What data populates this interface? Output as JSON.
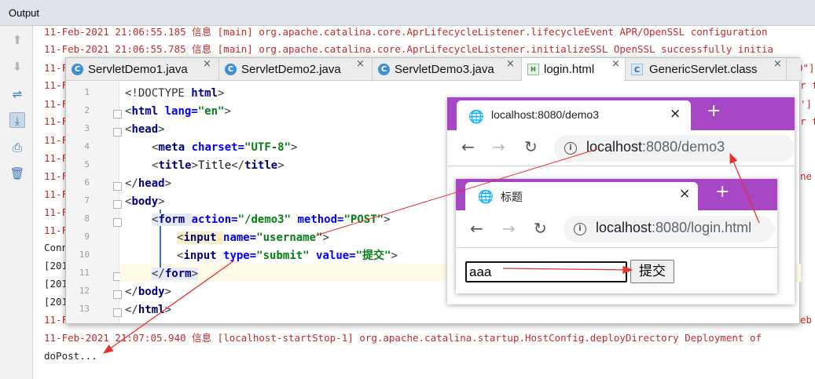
{
  "output": {
    "title": "Output",
    "log_lines": [
      {
        "text": "11-Feb-2021 21:06:55.185 信息 [main] org.apache.catalina.core.AprLifecycleListener.lifecycleEvent APR/OpenSSL configuration",
        "color": "red"
      },
      {
        "text": "11-Feb-2021 21:06:55.785 信息 [main] org.apache.catalina.core.AprLifecycleListener.initializeSSL OpenSSL successfully initia",
        "color": "red"
      },
      {
        "text": "11-F",
        "color": "red"
      },
      {
        "text": "11-F",
        "color": "red"
      },
      {
        "text": "11-F",
        "color": "red"
      },
      {
        "text": "11-F",
        "color": "red"
      },
      {
        "text": "11-F",
        "color": "red"
      },
      {
        "text": "11-F",
        "color": "red"
      },
      {
        "text": "11-F",
        "color": "red"
      },
      {
        "text": "11-F",
        "color": "red"
      },
      {
        "text": "11-F",
        "color": "red"
      },
      {
        "text": "11-F",
        "color": "red"
      },
      {
        "text": "Conn",
        "color": "black"
      },
      {
        "text": "[201",
        "color": "black"
      },
      {
        "text": "[201",
        "color": "black"
      },
      {
        "text": "[201",
        "color": "black"
      },
      {
        "text": "11-F",
        "color": "red"
      },
      {
        "text": "11-Feb-2021 21:07:05.940 信息 [localhost-startStop-1] org.apache.catalina.startup.HostConfig.deployDirectory Deployment of",
        "color": "red"
      },
      {
        "text": "doPost...",
        "color": "black"
      }
    ],
    "right_fragments": [
      "0\"]",
      "r f",
      "']",
      "r f",
      "ne",
      "eb"
    ]
  },
  "editor": {
    "tabs": [
      {
        "label": "ServletDemo1.java",
        "icon": "C",
        "close": "×",
        "active": false
      },
      {
        "label": "ServletDemo2.java",
        "icon": "C",
        "close": "×",
        "active": false
      },
      {
        "label": "ServletDemo3.java",
        "icon": "C",
        "close": "×",
        "active": false
      },
      {
        "label": "login.html",
        "icon": "H",
        "close": "×",
        "active": true
      },
      {
        "label": "GenericServlet.class",
        "icon": "C",
        "close": "×",
        "active": false
      }
    ],
    "line_numbers": [
      "1",
      "2",
      "3",
      "4",
      "5",
      "6",
      "7",
      "8",
      "9",
      "10",
      "11",
      "12",
      "13"
    ],
    "code": {
      "l1": {
        "a": "<!DOCTYPE ",
        "b": "html",
        "c": ">"
      },
      "l2": {
        "a": "<",
        "b": "html ",
        "c": "lang=",
        "d": "\"en\"",
        "e": ">"
      },
      "l3": {
        "a": "<",
        "b": "head",
        "c": ">"
      },
      "l4": {
        "a": "<",
        "b": "meta ",
        "c": "charset=",
        "d": "\"UTF-8\"",
        "e": ">"
      },
      "l5": {
        "a": "<",
        "b": "title",
        "c": ">",
        "d": "Title",
        "e": "</",
        "f": "title",
        "g": ">"
      },
      "l6": {
        "a": "</",
        "b": "head",
        "c": ">"
      },
      "l7": {
        "a": "<",
        "b": "body",
        "c": ">"
      },
      "l8": {
        "a": "<",
        "b": "form ",
        "c": "action=",
        "d": "\"/demo3\" ",
        "e": "method=",
        "f": "\"POST\"",
        "g": ">"
      },
      "l9": {
        "a": "<",
        "b": "input ",
        "c": "name=",
        "d": "\"username\"",
        "e": ">"
      },
      "l10": {
        "a": "<",
        "b": "input ",
        "c": "type=",
        "d": "\"submit\" ",
        "e": "value=",
        "f": "\"提交\"",
        "g": ">"
      },
      "l11": {
        "a": "</",
        "b": "form",
        "c": ">"
      },
      "l12": {
        "a": "</",
        "b": "body",
        "c": ">"
      },
      "l13": {
        "a": "</",
        "b": "html",
        "c": ">"
      }
    }
  },
  "browser_back": {
    "tab_title": "localhost:8080/demo3",
    "close": "×",
    "new_tab": "+",
    "url_host": "localhost",
    "url_rest": ":8080/demo3"
  },
  "browser_front": {
    "tab_title": "标题",
    "close": "×",
    "new_tab": "+",
    "url_host": "localhost",
    "url_rest": ":8080/login.html",
    "input_value": "aaa",
    "submit_label": "提交"
  },
  "colors": {
    "accent": "#a847c5",
    "log_red": "#c22b2b",
    "arrow": "#e8302f"
  }
}
